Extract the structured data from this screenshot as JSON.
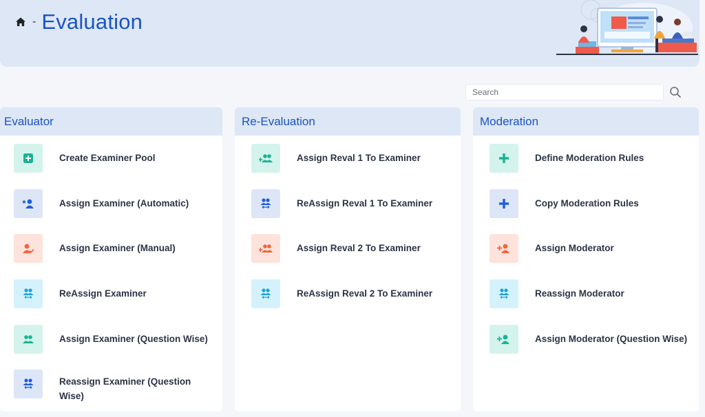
{
  "header": {
    "breadcrumb_separator": "-",
    "title": "Evaluation",
    "home_icon": "home-icon",
    "illustration": "people-computer-illustration"
  },
  "search": {
    "placeholder": "Search",
    "value": "",
    "icon": "search-icon"
  },
  "colors": {
    "accent": "#1a53c4",
    "header_bg": "#dde7f6",
    "green": "#19b394",
    "blue": "#1e5ed8",
    "orange": "#f2643c",
    "cyan": "#1aa3d6"
  },
  "cards": [
    {
      "title": "Evaluator",
      "items": [
        {
          "label": "Create Examiner Pool",
          "icon": "plus-square-icon",
          "tone": "green"
        },
        {
          "label": "Assign Examiner (Automatic)",
          "icon": "user-star-icon",
          "tone": "blue"
        },
        {
          "label": "Assign Examiner (Manual)",
          "icon": "user-check-icon",
          "tone": "orange"
        },
        {
          "label": "ReAssign Examiner",
          "icon": "users-swap-icon",
          "tone": "cyan"
        },
        {
          "label": "Assign Examiner (Question Wise)",
          "icon": "users-icon",
          "tone": "green"
        },
        {
          "label": "Reassign Examiner (Question Wise)",
          "icon": "users-swap-icon",
          "tone": "blue"
        }
      ]
    },
    {
      "title": "Re-Evaluation",
      "items": [
        {
          "label": "Assign Reval 1 To Examiner",
          "icon": "users-plus-icon",
          "tone": "green"
        },
        {
          "label": "ReAssign Reval 1 To Examiner",
          "icon": "users-swap-icon",
          "tone": "blue"
        },
        {
          "label": "Assign Reval 2 To Examiner",
          "icon": "users-plus-icon",
          "tone": "orange"
        },
        {
          "label": "ReAssign Reval 2 To Examiner",
          "icon": "users-swap-icon",
          "tone": "cyan"
        }
      ]
    },
    {
      "title": "Moderation",
      "items": [
        {
          "label": "Define Moderation Rules",
          "icon": "plus-icon",
          "tone": "green"
        },
        {
          "label": "Copy Moderation Rules",
          "icon": "plus-icon",
          "tone": "blue"
        },
        {
          "label": "Assign Moderator",
          "icon": "user-plus-icon",
          "tone": "orange"
        },
        {
          "label": "Reassign Moderator",
          "icon": "users-swap-icon",
          "tone": "cyan"
        },
        {
          "label": "Assign Moderator (Question Wise)",
          "icon": "user-plus-icon",
          "tone": "green"
        }
      ]
    }
  ]
}
